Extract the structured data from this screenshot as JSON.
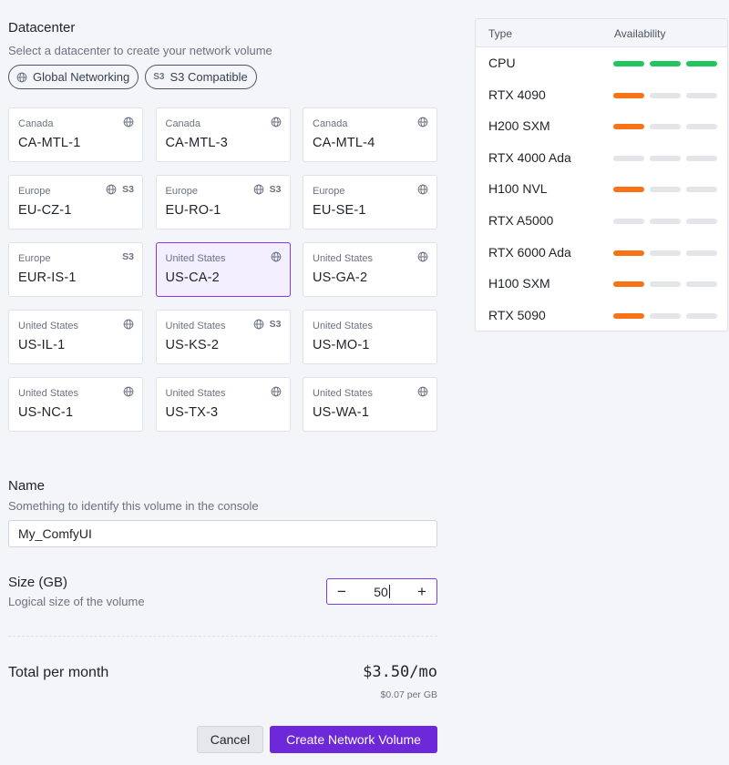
{
  "datacenter": {
    "title": "Datacenter",
    "subtitle": "Select a datacenter to create your network volume",
    "filters": [
      {
        "label": "Global Networking",
        "icon": "globe-icon"
      },
      {
        "label": "S3 Compatible",
        "icon": "s3-icon",
        "tag": "S3"
      }
    ],
    "selected": "US-CA-2",
    "cards": [
      {
        "region": "Canada",
        "code": "CA-MTL-1",
        "globe": true,
        "s3": false
      },
      {
        "region": "Canada",
        "code": "CA-MTL-3",
        "globe": true,
        "s3": false
      },
      {
        "region": "Canada",
        "code": "CA-MTL-4",
        "globe": true,
        "s3": false
      },
      {
        "region": "Europe",
        "code": "EU-CZ-1",
        "globe": true,
        "s3": true
      },
      {
        "region": "Europe",
        "code": "EU-RO-1",
        "globe": true,
        "s3": true
      },
      {
        "region": "Europe",
        "code": "EU-SE-1",
        "globe": true,
        "s3": false
      },
      {
        "region": "Europe",
        "code": "EUR-IS-1",
        "globe": false,
        "s3": true
      },
      {
        "region": "United States",
        "code": "US-CA-2",
        "globe": true,
        "s3": false
      },
      {
        "region": "United States",
        "code": "US-GA-2",
        "globe": true,
        "s3": false
      },
      {
        "region": "United States",
        "code": "US-IL-1",
        "globe": true,
        "s3": false
      },
      {
        "region": "United States",
        "code": "US-KS-2",
        "globe": true,
        "s3": true
      },
      {
        "region": "United States",
        "code": "US-MO-1",
        "globe": false,
        "s3": false
      },
      {
        "region": "United States",
        "code": "US-NC-1",
        "globe": true,
        "s3": false
      },
      {
        "region": "United States",
        "code": "US-TX-3",
        "globe": true,
        "s3": false
      },
      {
        "region": "United States",
        "code": "US-WA-1",
        "globe": true,
        "s3": false
      }
    ],
    "s3_tag": "S3"
  },
  "name": {
    "title": "Name",
    "subtitle": "Something to identify this volume in the console",
    "value": "My_ComfyUI"
  },
  "size": {
    "title": "Size (GB)",
    "subtitle": "Logical size of the volume",
    "value": "50",
    "minus": "−",
    "plus": "+"
  },
  "total": {
    "label": "Total per month",
    "value": "$3.50/mo",
    "per_gb": "$0.07 per GB"
  },
  "actions": {
    "cancel": "Cancel",
    "create": "Create Network Volume"
  },
  "availability": {
    "col_type": "Type",
    "col_availability": "Availability",
    "colors": {
      "high": "#22c55e",
      "low": "#f97316",
      "none": "#e3e5e8"
    },
    "rows": [
      {
        "type": "CPU",
        "level": 3,
        "status": "high"
      },
      {
        "type": "RTX 4090",
        "level": 1,
        "status": "low"
      },
      {
        "type": "H200 SXM",
        "level": 1,
        "status": "low"
      },
      {
        "type": "RTX 4000 Ada",
        "level": 0,
        "status": "none"
      },
      {
        "type": "H100 NVL",
        "level": 1,
        "status": "low"
      },
      {
        "type": "RTX A5000",
        "level": 0,
        "status": "none"
      },
      {
        "type": "RTX 6000 Ada",
        "level": 1,
        "status": "low"
      },
      {
        "type": "H100 SXM",
        "level": 1,
        "status": "low"
      },
      {
        "type": "RTX 5090",
        "level": 1,
        "status": "low"
      }
    ]
  }
}
